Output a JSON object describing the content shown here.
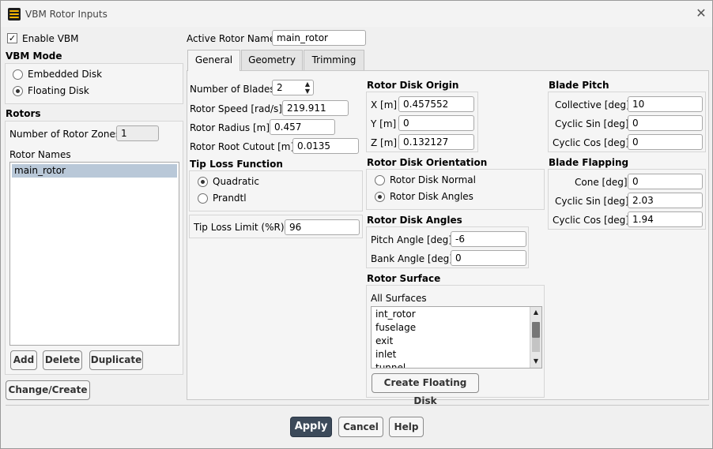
{
  "window": {
    "title": "VBM Rotor Inputs"
  },
  "left": {
    "enable_vbm_label": "Enable VBM",
    "vbm_mode_title": "VBM Mode",
    "mode_options": [
      "Embedded Disk",
      "Floating Disk"
    ],
    "selected_mode": "Floating Disk",
    "rotors_title": "Rotors",
    "num_zones_label": "Number of Rotor Zones",
    "num_zones_value": "1",
    "rotor_names_label": "Rotor Names",
    "rotor_names": [
      "main_rotor"
    ],
    "add_label": "Add",
    "delete_label": "Delete",
    "duplicate_label": "Duplicate",
    "change_create_label": "Change/Create"
  },
  "active_rotor": {
    "label": "Active Rotor Name",
    "value": "main_rotor"
  },
  "tabs": [
    "General",
    "Geometry",
    "Trimming"
  ],
  "general": {
    "num_blades_label": "Number of Blades",
    "num_blades_value": "2",
    "rotor_speed_label": "Rotor Speed [rad/s]",
    "rotor_speed_value": "219.911",
    "rotor_radius_label": "Rotor Radius [m]",
    "rotor_radius_value": "0.457",
    "root_cutout_label": "Rotor Root Cutout [m]",
    "root_cutout_value": "0.0135",
    "tip_loss_title": "Tip Loss Function",
    "tip_loss_options": [
      "Quadratic",
      "Prandtl"
    ],
    "tip_loss_limit_label": "Tip Loss Limit (%R)",
    "tip_loss_limit_value": "96"
  },
  "origin": {
    "title": "Rotor Disk Origin",
    "x_label": "X [m]",
    "x_value": "0.457552",
    "y_label": "Y [m]",
    "y_value": "0",
    "z_label": "Z [m]",
    "z_value": "0.132127"
  },
  "orientation": {
    "title": "Rotor Disk Orientation",
    "options": [
      "Rotor Disk Normal",
      "Rotor Disk Angles"
    ]
  },
  "angles": {
    "title": "Rotor Disk Angles",
    "pitch_label": "Pitch Angle [deg]",
    "pitch_value": "-6",
    "bank_label": "Bank Angle [deg]",
    "bank_value": "0"
  },
  "surface": {
    "title": "Rotor Surface",
    "all_label": "All Surfaces",
    "items": [
      "int_rotor",
      "fuselage",
      "exit",
      "inlet",
      "tunnel"
    ],
    "create_label": "Create Floating Disk"
  },
  "pitch": {
    "title": "Blade Pitch",
    "collective_label": "Collective [deg]",
    "collective_value": "10",
    "cyclic_sin_label": "Cyclic Sin [deg]",
    "cyclic_sin_value": "0",
    "cyclic_cos_label": "Cyclic Cos [deg]",
    "cyclic_cos_value": "0"
  },
  "flapping": {
    "title": "Blade Flapping",
    "cone_label": "Cone [deg]",
    "cone_value": "0",
    "cyclic_sin_label": "Cyclic Sin [deg]",
    "cyclic_sin_value": "2.03",
    "cyclic_cos_label": "Cyclic Cos [deg]",
    "cyclic_cos_value": "1.94"
  },
  "footer": {
    "apply_label": "Apply",
    "cancel_label": "Cancel",
    "help_label": "Help"
  }
}
